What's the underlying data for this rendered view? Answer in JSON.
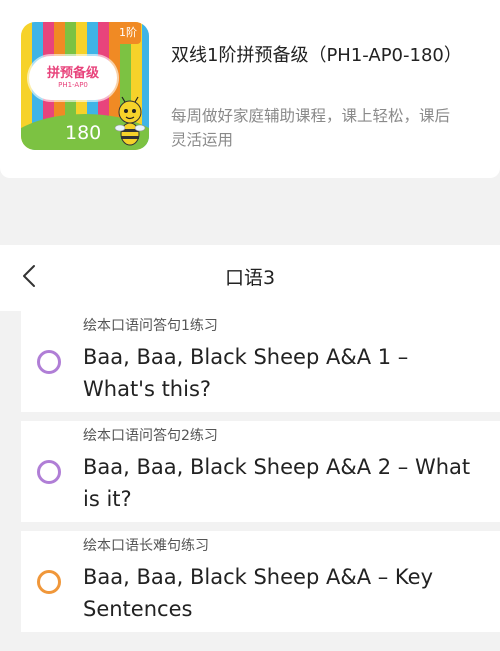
{
  "course": {
    "thumbnail": {
      "level_badge": "1阶",
      "title": "拼预备级",
      "subtitle": "PH1-AP0",
      "number": "180"
    },
    "title": "双线1阶拼预备级（PH1-AP0-180）",
    "description": "每周做好家庭辅助课程，课上轻松，课后灵活运用"
  },
  "section": {
    "title": "口语3",
    "back_icon": "chevron-left-icon"
  },
  "items": [
    {
      "subtitle": "绘本口语问答句1练习",
      "title": "Baa, Baa, Black Sheep A&A 1 – What's this?",
      "circle_color": "#b07ed6"
    },
    {
      "subtitle": "绘本口语问答句2练习",
      "title": "Baa, Baa, Black Sheep A&A 2 – What is it?",
      "circle_color": "#b07ed6"
    },
    {
      "subtitle": "绘本口语长难句练习",
      "title": "Baa, Baa, Black Sheep A&A – Key Sentences",
      "circle_color": "#f0973a"
    }
  ]
}
